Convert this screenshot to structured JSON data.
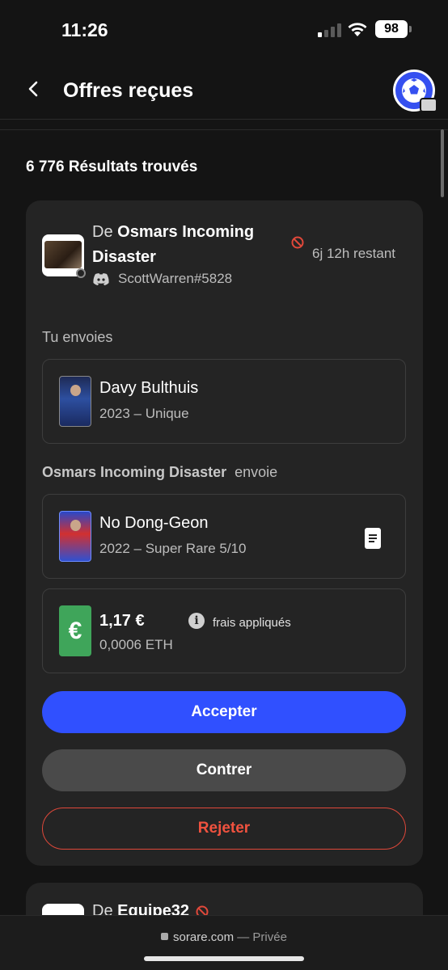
{
  "status": {
    "time": "11:26",
    "battery": "98"
  },
  "header": {
    "title": "Offres reçues",
    "back_icon": "chevron-left-icon",
    "avatar_icon": "soccer-ball-icon"
  },
  "results_text": "6 776 Résultats trouvés",
  "offer": {
    "from_prefix": "De",
    "from_name": "Osmars Incoming Disaster",
    "time_left": "6j 12h restant",
    "discord": "ScottWarren#5828",
    "send_label": "Tu envoies",
    "sent_card": {
      "name": "Davy Bulthuis",
      "detail": "2023 – Unique"
    },
    "other_name": "Osmars Incoming Disaster",
    "other_suffix": "envoie",
    "received_card": {
      "name": "No Dong-Geon",
      "detail": "2022 – Super Rare 5/10"
    },
    "money": {
      "symbol": "€",
      "eur": "1,17 €",
      "eth": "0,0006 ETH",
      "fees": "frais appliqués"
    },
    "accept": "Accepter",
    "counter": "Contrer",
    "reject": "Rejeter"
  },
  "next_offer": {
    "from_prefix": "De",
    "from_name": "Equipe32"
  },
  "browser": {
    "domain": "sorare.com",
    "mode": "— Privée"
  },
  "colors": {
    "accent": "#3050ff",
    "reject": "#f0523f",
    "money": "#3fa55a",
    "background": "#141414",
    "card": "#242424"
  }
}
